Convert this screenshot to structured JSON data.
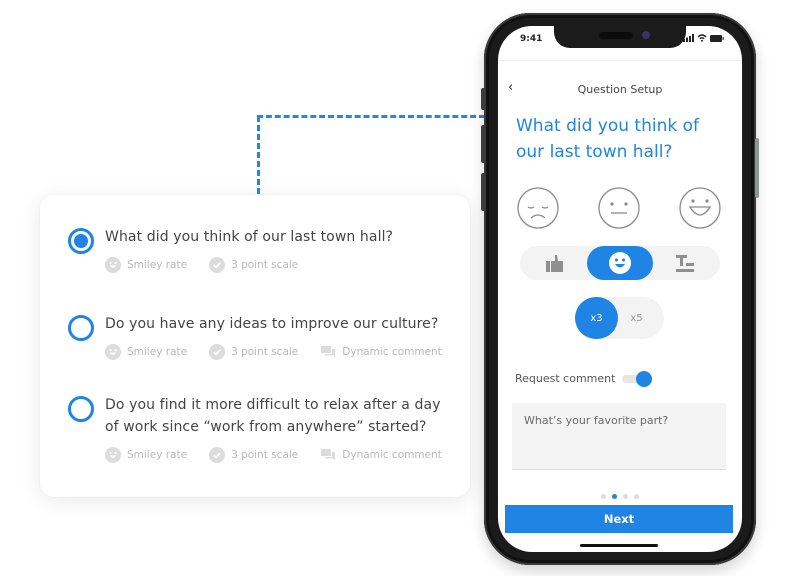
{
  "card": {
    "questions": [
      {
        "text": "What did you think of our last town hall?",
        "selected": true,
        "tags": [
          {
            "icon": "smiley-icon",
            "label": "Smiley rate"
          },
          {
            "icon": "check-circle-icon",
            "label": "3 point scale"
          }
        ]
      },
      {
        "text": "Do you have any ideas to improve our culture?",
        "selected": false,
        "tags": [
          {
            "icon": "smiley-icon",
            "label": "Smiley rate"
          },
          {
            "icon": "check-circle-icon",
            "label": "3 point scale"
          },
          {
            "icon": "chat-bubbles-icon",
            "label": "Dynamic comment"
          }
        ]
      },
      {
        "text": "Do you find it more difficult to relax after a day of work since “work from anywhere” started?",
        "selected": false,
        "tags": [
          {
            "icon": "smiley-icon",
            "label": "Smiley rate"
          },
          {
            "icon": "check-circle-icon",
            "label": "3 point scale"
          },
          {
            "icon": "chat-bubbles-icon",
            "label": "Dynamic comment"
          }
        ]
      }
    ]
  },
  "phone": {
    "status": {
      "time": "9:41"
    },
    "nav": {
      "back_icon": "‹",
      "title": "Question Setup"
    },
    "prompt": "What did you think of our last town hall?",
    "faces": [
      "sad-face-icon",
      "neutral-face-icon",
      "happy-face-icon"
    ],
    "type_options": [
      {
        "icon": "thumbs-up-icon",
        "active": false
      },
      {
        "icon": "smiley-icon",
        "active": true
      },
      {
        "icon": "text-icon",
        "active": false
      }
    ],
    "scale_options": [
      {
        "label": "x3",
        "active": true
      },
      {
        "label": "x5",
        "active": false
      }
    ],
    "request_comment": {
      "label": "Request comment",
      "enabled": true
    },
    "comment_placeholder": "What’s your favorite part?",
    "pagination": {
      "total": 4,
      "current": 2
    },
    "next_label": "Next"
  },
  "colors": {
    "accent": "#1f84e3",
    "muted": "#b8b8b8"
  }
}
